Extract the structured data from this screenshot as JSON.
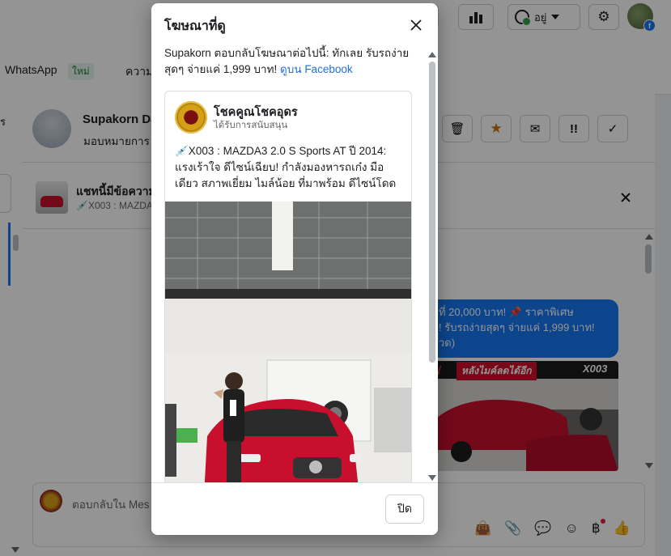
{
  "topbar": {
    "status_label": "อยู่"
  },
  "tabs": {
    "whatsapp": "WhatsApp",
    "new_badge": "ใหม่",
    "next_tab_partial": "ความ"
  },
  "left": {
    "partial_letter": "ร"
  },
  "conversation": {
    "contact_name": "Supakorn Da",
    "contact_sub": "มอบหมายการ",
    "ad_title": "แชทนี้มีข้อความ",
    "ad_sub": "💉X003 : MAZDA",
    "bubble_lines": [
      "ที่ 20,000 บาท! 📌 ราคาพิเศษ",
      "! รับรถง่ายสุดๆ จ่ายแค่ 1,999 บาท!",
      "วด)"
    ],
    "promo_banner": "หลังไมค์ลดได้อีก",
    "promo_banner_left": "ม่",
    "promo_code": "X003",
    "composer_placeholder": "ตอบกลับใน Mes"
  },
  "modal": {
    "title": "โฆษณาที่ดู",
    "description": "Supakorn ตอบกลับโฆษณาต่อไปนี้: ทักเลย รับรถง่ายสุดๆ จ่ายแค่ 1,999 บาท!",
    "description_link": "ดูบน Facebook",
    "page_name": "โชคคูณโชคอุดร",
    "sponsored": "ได้รับการสนับสนุน",
    "ad_text": "💉X003 : MAZDA3 2.0 S Sports AT ปี 2014: แรงเร้าใจ ดีไซน์เฉียบ! กำลังมองหารถเก๋ง มือเดียว สภาพเยี่ยม ไมล์น้อย ที่มาพร้อม ดีไซน์โดดเด่น...",
    "close_button": "ปิด"
  },
  "colors": {
    "accent": "#1877f2",
    "car_red": "#c8102e"
  }
}
